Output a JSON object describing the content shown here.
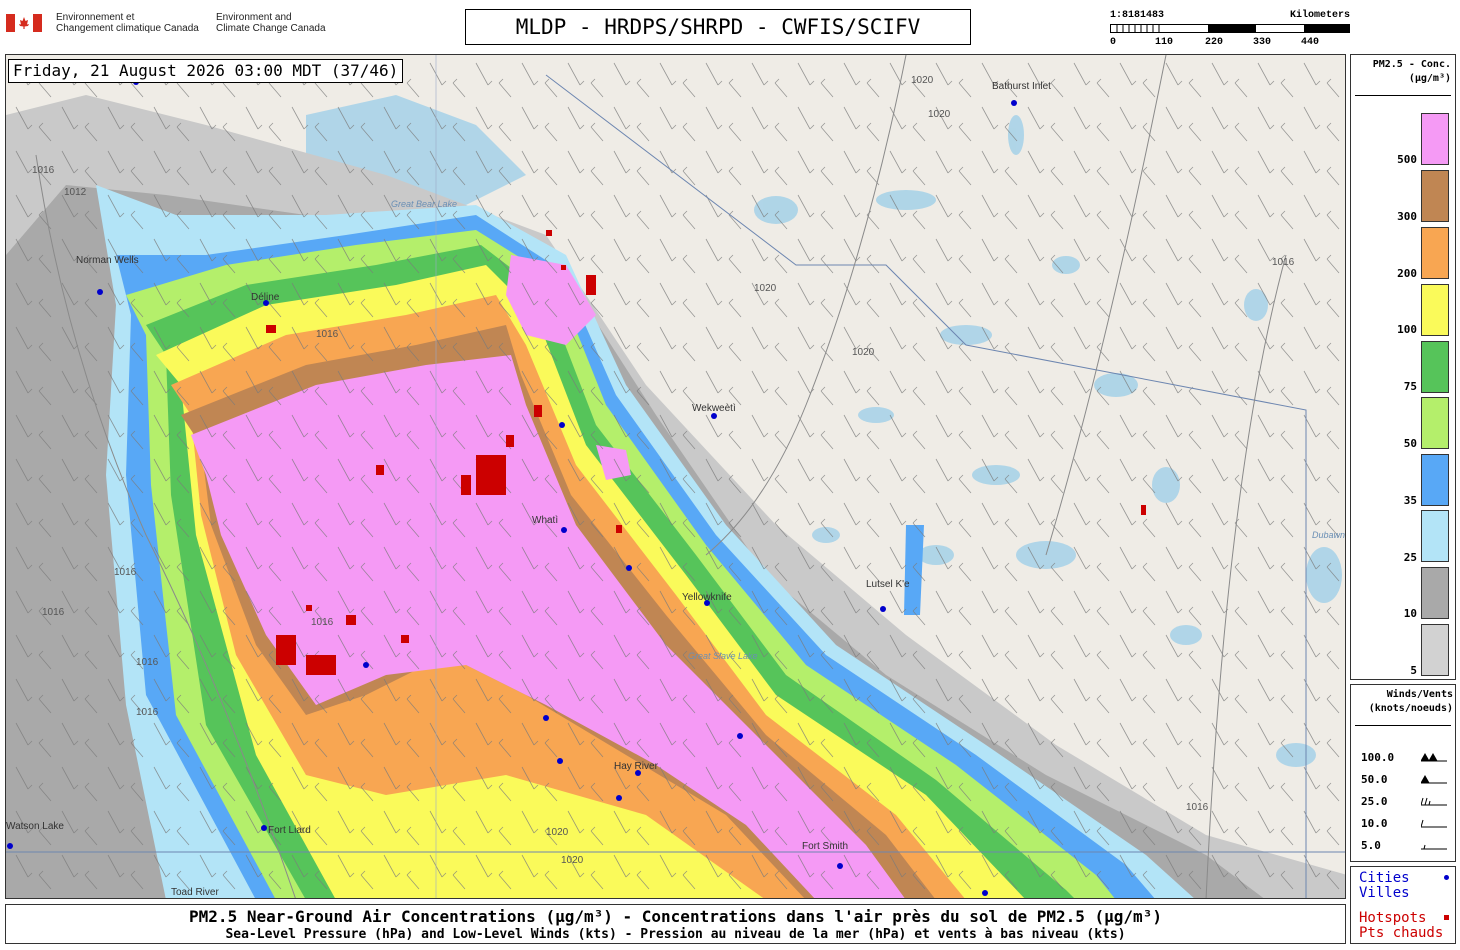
{
  "header": {
    "gov_fr": "Environnement et\nChangement climatique Canada",
    "gov_en": "Environment and\nClimate Change Canada",
    "title": "MLDP - HRDPS/SHRPD - CWFIS/SCIFV",
    "scale": {
      "ratio": "1:8181483",
      "unit": "Kilometers",
      "ticks": [
        "0",
        "110",
        "220",
        "330",
        "440"
      ]
    }
  },
  "map": {
    "timestamp": "Friday, 21 August 2026 03:00 MDT (37/46)",
    "cities": [
      "Bathurst Inlet",
      "Norman Wells",
      "Wekweètì",
      "Whatì",
      "Yellowknife",
      "Lutsel K'e",
      "Hay River",
      "Fort Smith",
      "Fort Liard",
      "Toad River",
      "Watson Lake",
      "Déline"
    ],
    "water_labels": [
      "Great Slave Lake",
      "Great Bear Lake",
      "Dubawnt Lake"
    ],
    "isobars": [
      "1016",
      "1012",
      "1020",
      "1020",
      "1020",
      "1020",
      "1016",
      "1016",
      "1016",
      "1016",
      "1016",
      "1016",
      "1016",
      "1020",
      "1020",
      "1016",
      "1016"
    ]
  },
  "legend": {
    "title": "PM2.5 - Conc.\n(µg/m³)",
    "levels": [
      {
        "label": "500",
        "color": "#f59af5"
      },
      {
        "label": "300",
        "color": "#c08653"
      },
      {
        "label": "200",
        "color": "#f8a652"
      },
      {
        "label": "100",
        "color": "#fafa5a"
      },
      {
        "label": "75",
        "color": "#56c45a"
      },
      {
        "label": "50",
        "color": "#b4ef6b"
      },
      {
        "label": "35",
        "color": "#58a8f6"
      },
      {
        "label": "25",
        "color": "#b3e4f7"
      },
      {
        "label": "10",
        "color": "#a9a9a9"
      },
      {
        "label": "5",
        "color": "#d2d2d2"
      }
    ],
    "winds": {
      "title": "Winds/Vents\n(knots/noeuds)",
      "rows": [
        "100.0",
        "50.0",
        "25.0",
        "10.0",
        "5.0"
      ]
    },
    "marks": {
      "cities": "Cities",
      "villes": "Villes",
      "hotspots": "Hotspots",
      "pts_chauds": "Pts chauds",
      "city_color": "#0000cc",
      "hotspot_color": "#cc0000"
    }
  },
  "footer": {
    "line1": "PM2.5 Near-Ground Air Concentrations (µg/m³) - Concentrations dans l'air près du sol de PM2.5 (µg/m³)",
    "line2": "Sea-Level Pressure (hPa) and Low-Level Winds (kts) - Pression au niveau de la mer (hPa) et vents à bas niveau (kts)"
  }
}
